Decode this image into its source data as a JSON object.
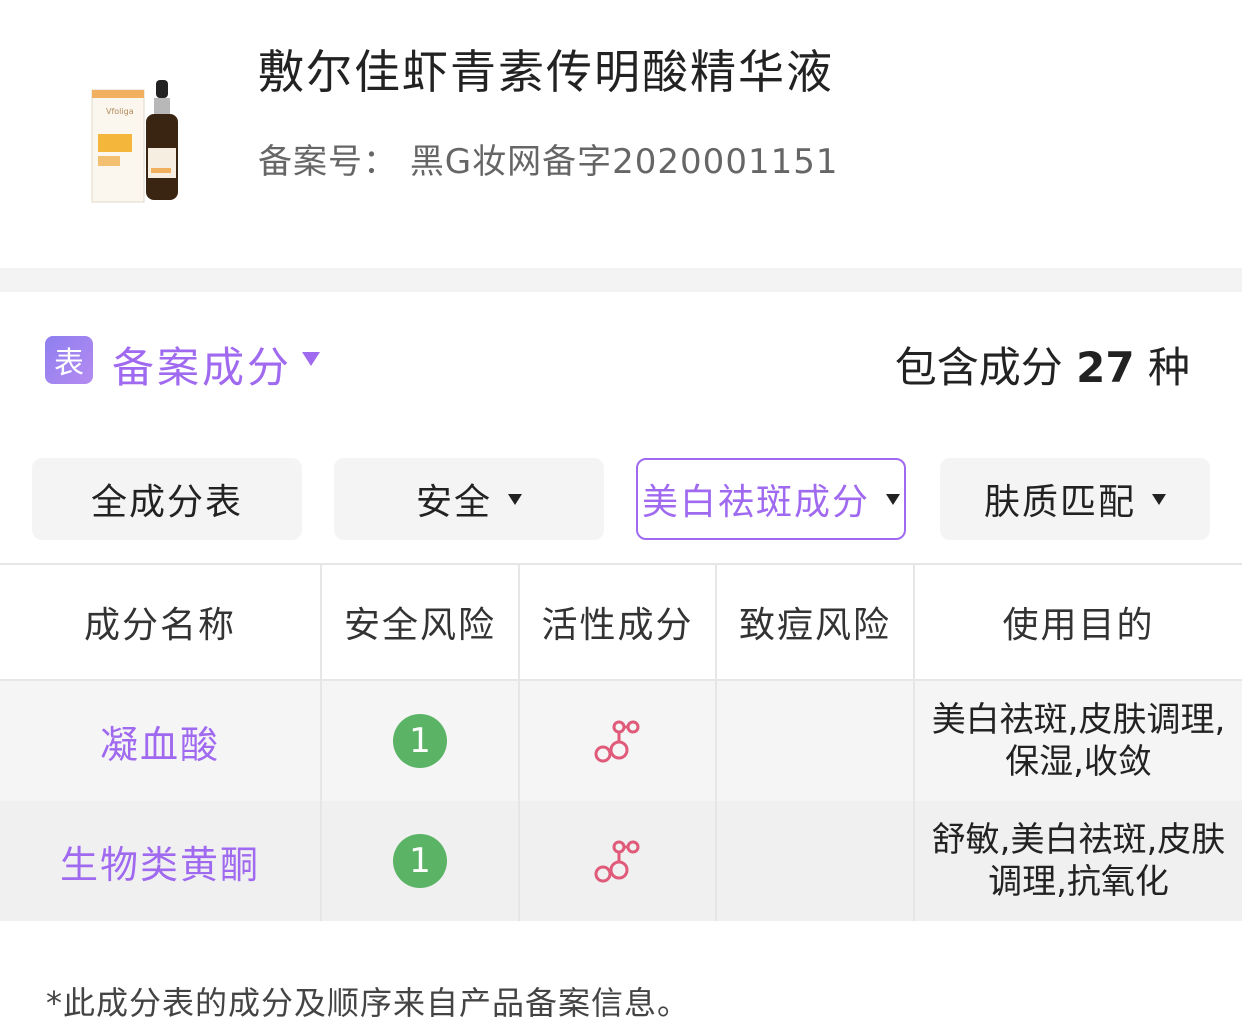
{
  "product": {
    "title": "敷尔佳虾青素传明酸精华液",
    "registration_label": "备案号：",
    "registration_number": "黑G妆网备字2020001151",
    "image_brand_text": "Vfoliga"
  },
  "section": {
    "badge": "表",
    "title": "备案成分",
    "count_prefix": "包含成分",
    "count": "27",
    "count_suffix": "种"
  },
  "filters": [
    {
      "label": "全成分表",
      "has_dropdown": false,
      "active": false
    },
    {
      "label": "安全",
      "has_dropdown": true,
      "active": false
    },
    {
      "label": "美白祛斑成分",
      "has_dropdown": true,
      "active": true
    },
    {
      "label": "肤质匹配",
      "has_dropdown": true,
      "active": false
    }
  ],
  "table": {
    "headers": [
      "成分名称",
      "安全风险",
      "活性成分",
      "致痘风险",
      "使用目的"
    ],
    "rows": [
      {
        "name": "凝血酸",
        "safety_score": "1",
        "active_icon": "molecule-icon",
        "acne_risk": "",
        "purpose": [
          "美白祛斑,皮肤调理,",
          "保湿,收敛"
        ]
      },
      {
        "name": "生物类黄酮",
        "safety_score": "1",
        "active_icon": "molecule-icon",
        "acne_risk": "",
        "purpose": [
          "舒敏,美白祛斑,皮肤",
          "调理,抗氧化"
        ]
      }
    ]
  },
  "footnote": "*此成分表的成分及顺序来自产品备案信息。",
  "colors": {
    "accent": "#a06af0",
    "score_green": "#5bb466",
    "molecule_pink": "#e05a7a",
    "badge_gradient_start": "#8e7ff0"
  }
}
